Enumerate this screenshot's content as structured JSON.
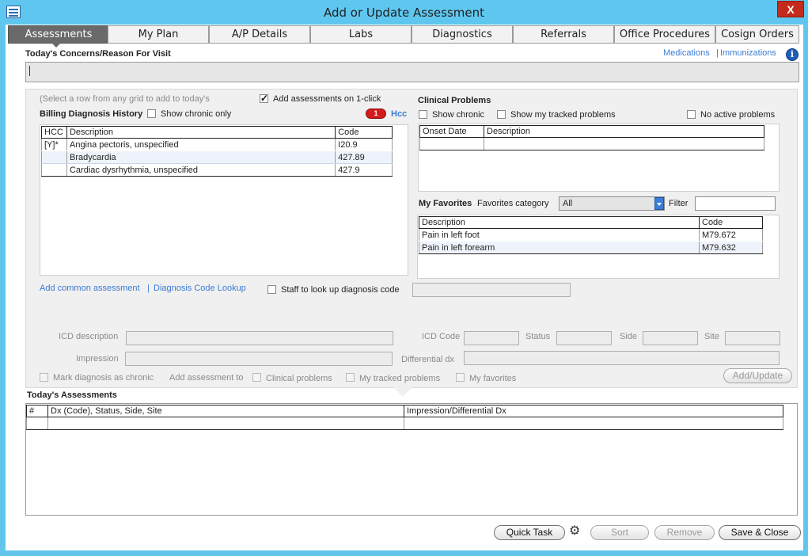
{
  "window": {
    "title": "Add or Update Assessment",
    "close_label": "X"
  },
  "tabs": [
    "Assessments",
    "My Plan",
    "A/P Details",
    "Labs",
    "Diagnostics",
    "Referrals",
    "Office Procedures",
    "Cosign Orders"
  ],
  "concerns": {
    "label": "Today's Concerns/Reason For Visit",
    "value": ""
  },
  "header_links": {
    "medications": "Medications",
    "separator": "|",
    "immunizations": "Immunizations",
    "info_icon": "i"
  },
  "billing": {
    "hint": "(Select a row from any grid to add to today's",
    "add_one_click": "Add assessments on 1-click",
    "title": "Billing Diagnosis History",
    "show_chronic_only": "Show chronic only",
    "hcc_badge": "1",
    "hcc_label": "Hcc",
    "columns": [
      "HCC",
      "Description",
      "Code"
    ],
    "rows": [
      [
        "[Y]*",
        "Angina pectoris, unspecified",
        "I20.9"
      ],
      [
        "",
        "Bradycardia",
        "427.89"
      ],
      [
        "",
        "Cardiac dysrhythmia, unspecified",
        "427.9"
      ]
    ]
  },
  "clinical": {
    "title": "Clinical Problems",
    "show_chronic": "Show chronic",
    "show_tracked": "Show my tracked problems",
    "no_active": "No active problems",
    "columns": [
      "Onset Date",
      "Description"
    ]
  },
  "favorites": {
    "title": "My Favorites",
    "category_label": "Favorites category",
    "category_value": "All",
    "filter_label": "Filter",
    "filter_value": "",
    "columns": [
      "Description",
      "Code"
    ],
    "rows": [
      [
        "Pain in left foot",
        "M79.672"
      ],
      [
        "Pain in left forearm",
        "M79.632"
      ]
    ]
  },
  "lookup": {
    "add_common": "Add common assessment",
    "separator": "|",
    "diag_lookup": "Diagnosis Code Lookup",
    "staff_lookup": "Staff to look up diagnosis code"
  },
  "details": {
    "icd_description": "ICD description",
    "impression": "Impression",
    "icd_code": "ICD Code",
    "status": "Status",
    "side": "Side",
    "site": "Site",
    "differential": "Differential dx",
    "mark_chronic": "Mark diagnosis as chronic",
    "add_to": "Add assessment to",
    "clinical_problems": "Clinical problems",
    "tracked_problems": "My tracked problems",
    "my_favorites": "My favorites",
    "add_update": "Add/Update"
  },
  "today": {
    "title": "Today's Assessments",
    "columns": [
      "#",
      "Dx (Code), Status, Side, Site",
      "Impression/Differential Dx"
    ]
  },
  "footer": {
    "quick_task": "Quick Task",
    "sort": "Sort",
    "remove": "Remove",
    "save_close": "Save & Close"
  }
}
